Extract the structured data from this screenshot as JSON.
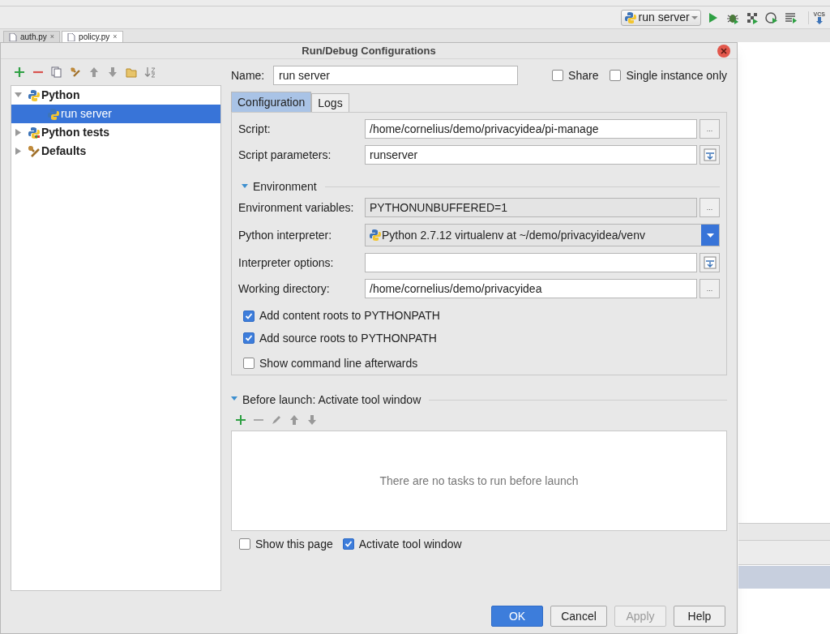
{
  "ide": {
    "run_config": "run server",
    "vcs_label": "VCS",
    "tabs": [
      {
        "label": "auth.py",
        "selected": false,
        "close": "×"
      },
      {
        "label": "policy.py",
        "selected": true,
        "close": "×"
      }
    ]
  },
  "dialog": {
    "title": "Run/Debug Configurations",
    "tree": [
      {
        "label": "Python",
        "kind": "python",
        "expanded": true,
        "selected": false,
        "children": [
          {
            "label": "run server",
            "kind": "python",
            "selected": true
          }
        ]
      },
      {
        "label": "Python tests",
        "kind": "tests",
        "expanded": false,
        "selected": false
      },
      {
        "label": "Defaults",
        "kind": "defaults",
        "expanded": false,
        "selected": false
      }
    ],
    "name": {
      "label": "Name:",
      "value": "run server"
    },
    "options": [
      {
        "label": "Share",
        "checked": false
      },
      {
        "label": "Single instance only",
        "checked": false
      }
    ],
    "tabs": [
      {
        "label": "Configuration",
        "selected": true
      },
      {
        "label": "Logs",
        "selected": false
      }
    ],
    "rows": [
      {
        "kind": "browse",
        "label": "Script:",
        "value": "/home/cornelius/demo/privacyidea/pi-manage",
        "button": "..."
      },
      {
        "kind": "expand",
        "label": "Script parameters:",
        "value": "runserver"
      },
      {
        "kind": "section",
        "label": "Environment",
        "expanded": true
      },
      {
        "kind": "readonly",
        "label": "Environment variables:",
        "value": "PYTHONUNBUFFERED=1",
        "button": "..."
      },
      {
        "kind": "dropdown",
        "label": "Python interpreter:",
        "value": "Python 2.7.12 virtualenv at ~/demo/privacyidea/venv"
      },
      {
        "kind": "expand",
        "label": "Interpreter options:",
        "value": ""
      },
      {
        "kind": "browse",
        "label": "Working directory:",
        "value": "/home/cornelius/demo/privacyidea",
        "button": "..."
      }
    ],
    "checks": [
      {
        "label": "Add content roots to PYTHONPATH",
        "checked": true
      },
      {
        "label": "Add source roots to PYTHONPATH",
        "checked": true
      },
      {
        "label": "Show command line afterwards",
        "checked": false
      }
    ],
    "before_launch": {
      "label": "Before launch: Activate tool window",
      "expanded": true,
      "empty_text": "There are no tasks to run before launch"
    },
    "bottom_checks": [
      {
        "label": "Show this page",
        "checked": false
      },
      {
        "label": "Activate tool window",
        "checked": true
      }
    ],
    "buttons": [
      {
        "label": "OK",
        "kind": "default"
      },
      {
        "label": "Cancel",
        "kind": "normal"
      },
      {
        "label": "Apply",
        "kind": "disabled"
      },
      {
        "label": "Help",
        "kind": "normal"
      }
    ]
  }
}
